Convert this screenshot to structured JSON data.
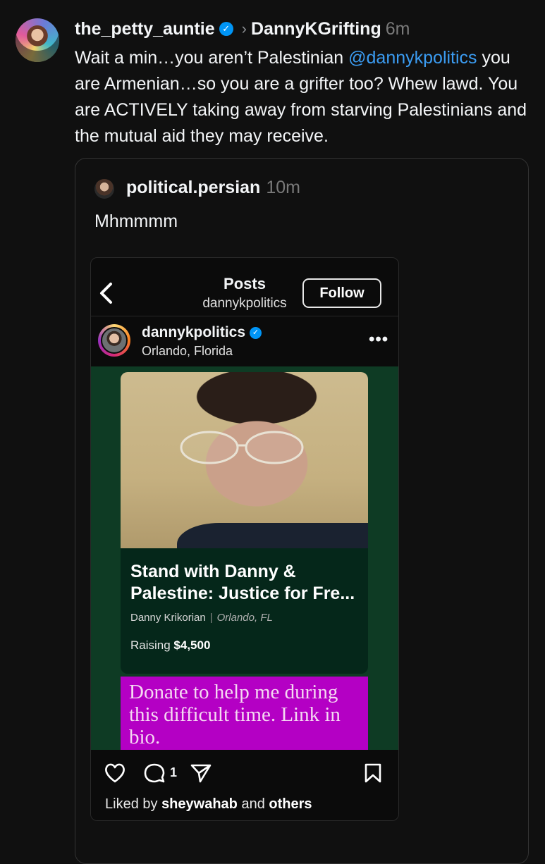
{
  "post": {
    "username": "the_petty_auntie",
    "reply_to": "DannyKGrifting",
    "time": "6m",
    "text_before": "Wait a min…you aren’t Palestinian ",
    "mention": "@dannykpolitics",
    "text_after": " you are Armenian…so you are a grifter too? Whew lawd. You are ACTIVELY taking away from starving Palestinians and the mutual aid they may receive."
  },
  "quote": {
    "username": "political.persian",
    "time": "10m",
    "text": "Mhmmmm"
  },
  "instagram": {
    "header_title": "Posts",
    "header_handle": "dannykpolitics",
    "follow_label": "Follow",
    "username": "dannykpolitics",
    "location": "Orlando, Florida",
    "comment_count": "1",
    "liked_by_prefix": "Liked by ",
    "liked_by_user": "sheywahab",
    "liked_by_mid": " and ",
    "liked_by_others": "others"
  },
  "fundraiser": {
    "title": "Stand with Danny & Palestine: Justice for Fre...",
    "organizer": "Danny Krikorian",
    "location": "Orlando, FL",
    "raising_label": "Raising ",
    "raising_amount": "$4,500",
    "donate_text": "Donate to help me during this difficult time. Link in bio."
  },
  "colors": {
    "background": "#101010",
    "mention": "#3b9cf2",
    "verified": "#0095f6",
    "donate_bg": "#b400c4",
    "image_bg": "#0e3b24"
  },
  "icons": [
    "verified-badge-icon",
    "chevron-right-icon",
    "back-arrow-icon",
    "more-icon",
    "heart-icon",
    "comment-icon",
    "share-icon",
    "bookmark-icon"
  ]
}
